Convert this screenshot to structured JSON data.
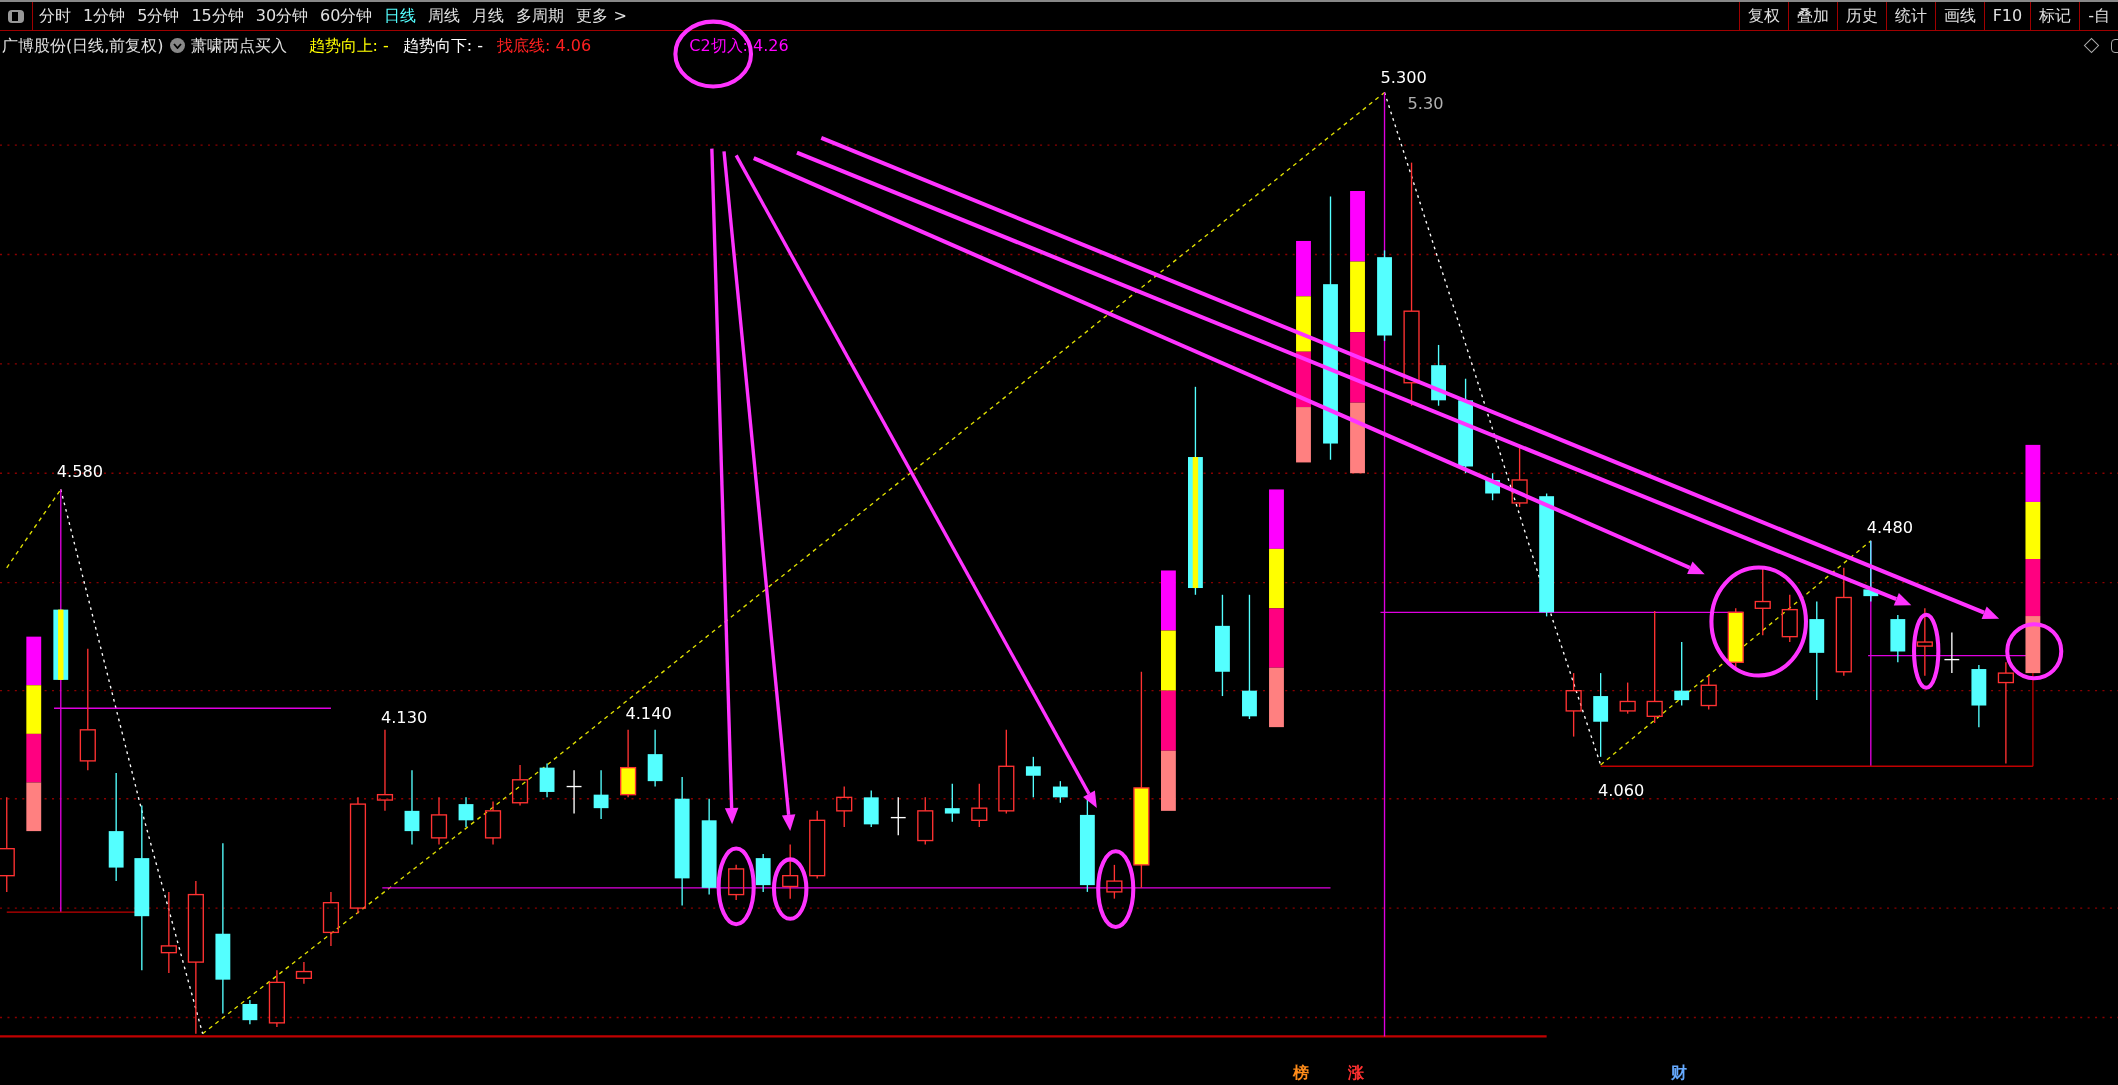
{
  "toolbar": {
    "periods": [
      {
        "label": "分时",
        "selected": false
      },
      {
        "label": "1分钟",
        "selected": false
      },
      {
        "label": "5分钟",
        "selected": false
      },
      {
        "label": "15分钟",
        "selected": false
      },
      {
        "label": "30分钟",
        "selected": false
      },
      {
        "label": "60分钟",
        "selected": false
      },
      {
        "label": "日线",
        "selected": true
      },
      {
        "label": "周线",
        "selected": false
      },
      {
        "label": "月线",
        "selected": false
      },
      {
        "label": "多周期",
        "selected": false
      },
      {
        "label": "更多 >",
        "selected": false
      }
    ],
    "tools": [
      "复权",
      "叠加",
      "历史",
      "统计",
      "画线",
      "F10",
      "标记",
      "-自"
    ]
  },
  "info_bar": {
    "title": "广博股份(日线,前复权)",
    "indicator": "萧啸两点买入",
    "readings": [
      {
        "label": "趋势向上:",
        "value": "-",
        "color": "#ffff00"
      },
      {
        "label": "趋势向下:",
        "value": "-",
        "color": "#ffffff"
      },
      {
        "label": "找底线:",
        "value": "4.06",
        "color": "#ff2020"
      },
      {
        "label": "C2切入:",
        "value": "4.26",
        "color": "#ff00ff"
      }
    ]
  },
  "price_labels": [
    "4.580",
    "5.300",
    "5.30",
    "4.130",
    "4.140",
    "4.480",
    "4.060"
  ],
  "markers": [
    {
      "text": "榜",
      "color": "#ff8c1a"
    },
    {
      "text": "涨",
      "color": "#ff3030"
    },
    {
      "text": "财",
      "color": "#66aaff"
    }
  ]
}
